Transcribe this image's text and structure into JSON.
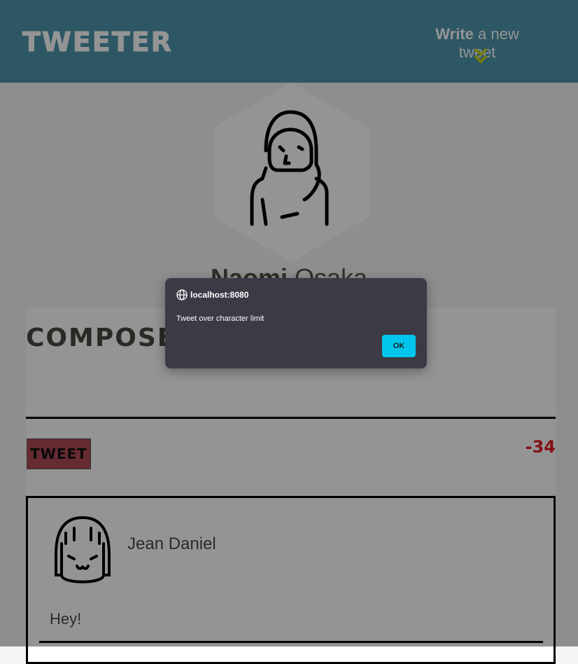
{
  "nav": {
    "logo": "TWEETER",
    "write_bold": "Write",
    "write_rest": " a new tweet"
  },
  "profile": {
    "first_name": "Naomi",
    "last_name": " Osaka"
  },
  "compose": {
    "title": "COMPOSE TWEET",
    "tweet_button": "TWEET",
    "counter": "-34"
  },
  "tweet": {
    "author": "Jean Daniel",
    "content": "Hey!"
  },
  "dialog": {
    "origin": "localhost:8080",
    "message": "Tweet over character limit",
    "ok_label": "OK"
  },
  "colors": {
    "nav_bg": "#4e96ac",
    "chevron": "#c9d51f",
    "counter": "#e21e22",
    "ok_button": "#00c6ed"
  }
}
